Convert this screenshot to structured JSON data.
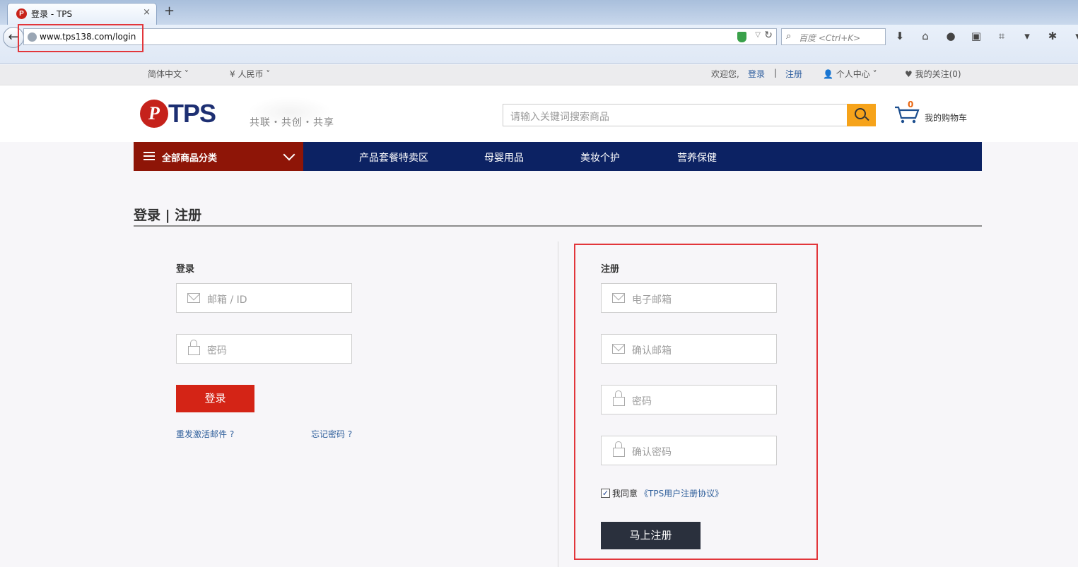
{
  "browser": {
    "tab_title": "登录 - TPS",
    "favicon_letter": "P",
    "close_glyph": "×",
    "newtab_glyph": "+",
    "back_glyph": "←",
    "url": "www.tps138.com/login",
    "search_placeholder": "百度 <Ctrl+K>"
  },
  "topbar": {
    "language": "简体中文",
    "currency": "¥ 人民币",
    "welcome": "欢迎您,",
    "login": "登录",
    "separator": "|",
    "register": "注册",
    "personal_center": "个人中心",
    "follows": "我的关注(0)"
  },
  "header": {
    "logo_letter": "P",
    "logo_text": "TPS",
    "slogan": "共联・共创・共享",
    "search_placeholder": "请输入关键词搜索商品",
    "cart_count": "0",
    "cart_label": "我的购物车"
  },
  "nav": {
    "all_categories": "全部商品分类",
    "links": [
      "产品套餐特卖区",
      "母婴用品",
      "美妆个护",
      "营养保健"
    ]
  },
  "page": {
    "title": "登录 | 注册"
  },
  "login": {
    "heading": "登录",
    "email_placeholder": "邮箱 / ID",
    "password_placeholder": "密码",
    "submit": "登录",
    "resend_activation": "重发激活邮件 ?",
    "forgot_password": "忘记密码 ?"
  },
  "register": {
    "heading": "注册",
    "email_placeholder": "电子邮箱",
    "confirm_email_placeholder": "确认邮箱",
    "password_placeholder": "密码",
    "confirm_password_placeholder": "确认密码",
    "checkbox_mark": "✓",
    "agree_text": "我同意",
    "agree_link": "《TPS用户注册协议》",
    "submit": "马上注册"
  },
  "colors": {
    "accent_red": "#d42416",
    "nav_blue": "#0c2263",
    "category_red": "#8e1507",
    "search_orange": "#f6a31a",
    "register_button": "#2a303d",
    "highlight_red": "#e2363b"
  }
}
